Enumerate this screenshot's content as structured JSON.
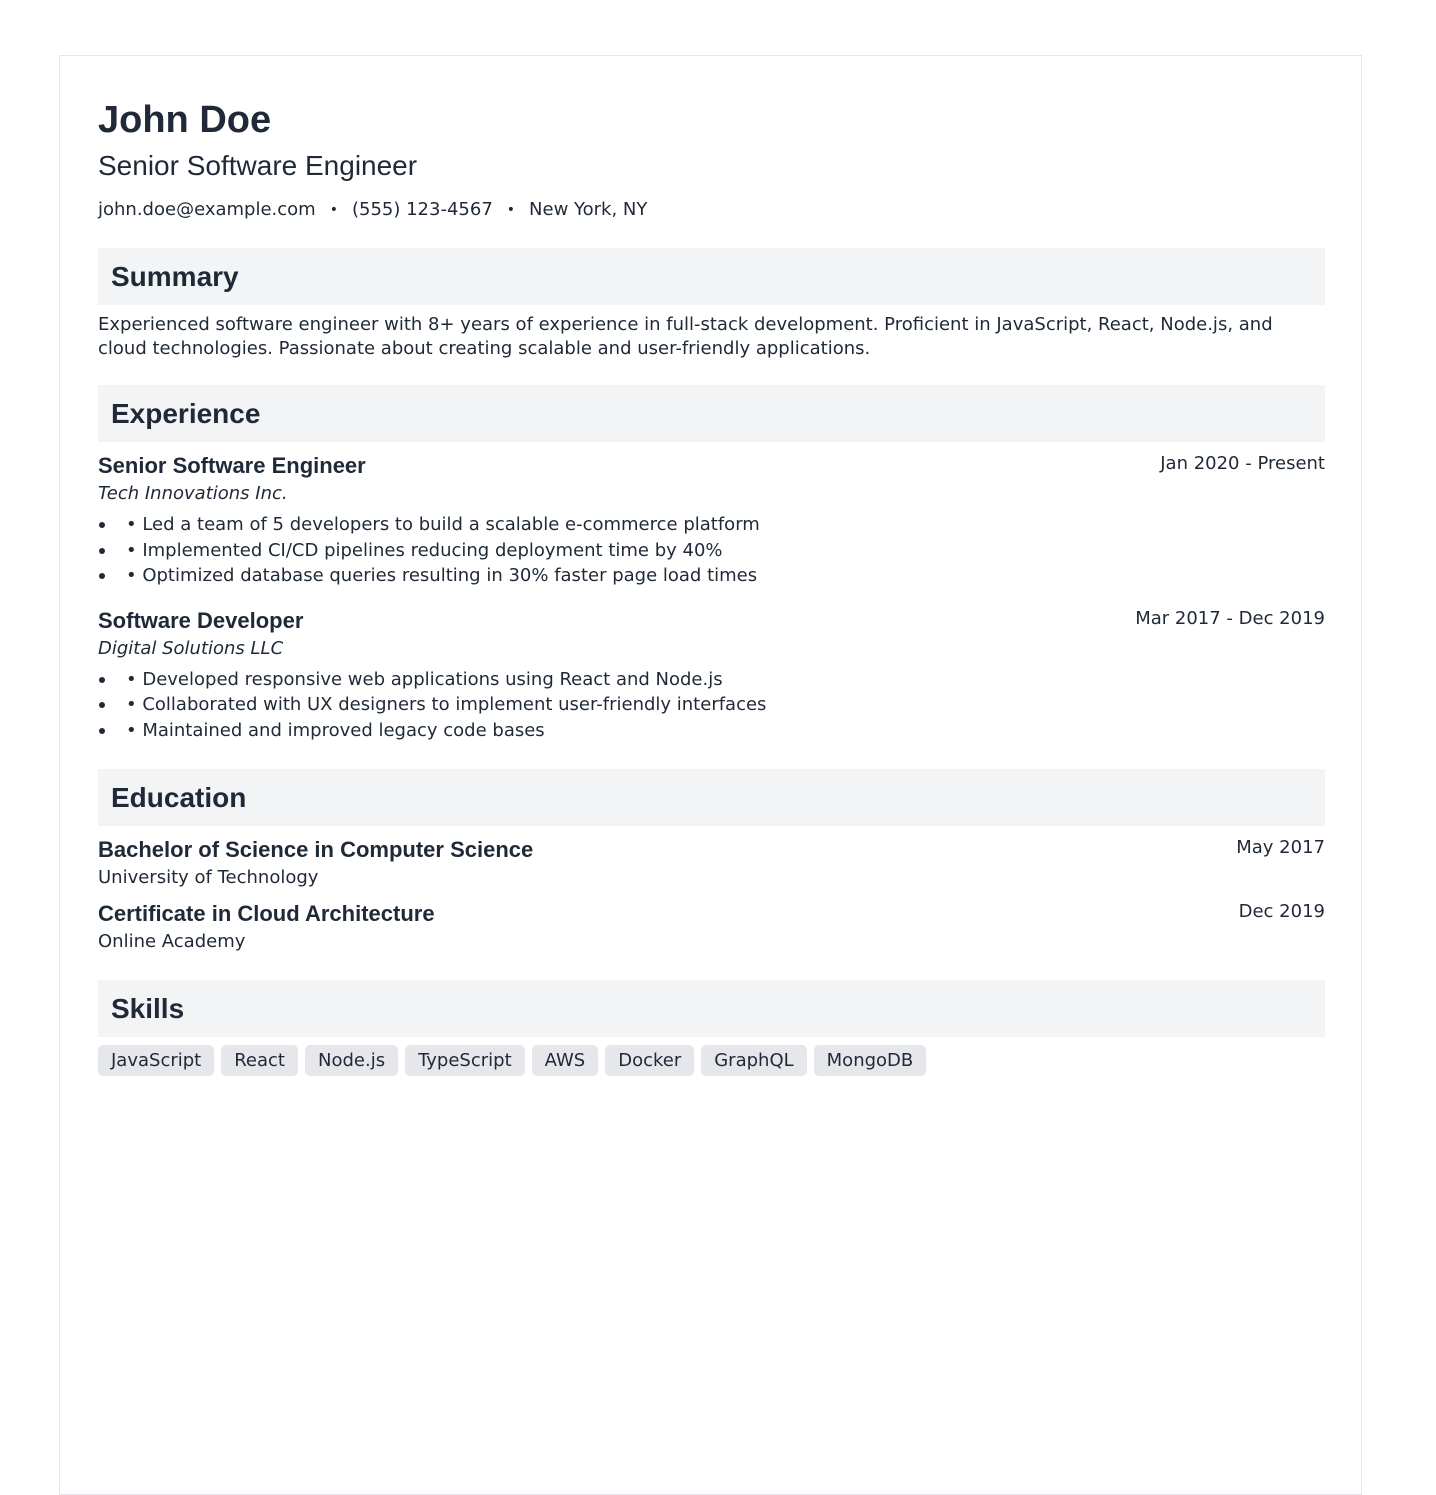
{
  "header": {
    "name": "John Doe",
    "title": "Senior Software Engineer",
    "email": "john.doe@example.com",
    "phone": "(555) 123-4567",
    "location": "New York, NY",
    "separator": "•"
  },
  "summary": {
    "heading": "Summary",
    "text": "Experienced software engineer with 8+ years of experience in full-stack development. Proficient in JavaScript, React, Node.js, and cloud technologies. Passionate about creating scalable and user-friendly applications."
  },
  "experience": {
    "heading": "Experience",
    "jobs": [
      {
        "title": "Senior Software Engineer",
        "company": "Tech Innovations Inc.",
        "dates": "Jan 2020 - Present",
        "bullets": [
          "• Led a team of 5 developers to build a scalable e-commerce platform",
          "• Implemented CI/CD pipelines reducing deployment time by 40%",
          "• Optimized database queries resulting in 30% faster page load times"
        ]
      },
      {
        "title": "Software Developer",
        "company": "Digital Solutions LLC",
        "dates": "Mar 2017 - Dec 2019",
        "bullets": [
          "• Developed responsive web applications using React and Node.js",
          "• Collaborated with UX designers to implement user-friendly interfaces",
          "• Maintained and improved legacy code bases"
        ]
      }
    ]
  },
  "education": {
    "heading": "Education",
    "items": [
      {
        "degree": "Bachelor of Science in Computer Science",
        "school": "University of Technology",
        "date": "May 2017"
      },
      {
        "degree": "Certificate in Cloud Architecture",
        "school": "Online Academy",
        "date": "Dec 2019"
      }
    ]
  },
  "skills": {
    "heading": "Skills",
    "items": [
      "JavaScript",
      "React",
      "Node.js",
      "TypeScript",
      "AWS",
      "Docker",
      "GraphQL",
      "MongoDB"
    ]
  }
}
